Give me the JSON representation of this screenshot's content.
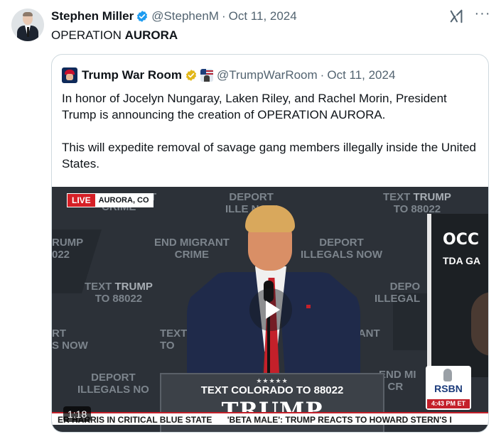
{
  "post": {
    "author_name": "Stephen Miller",
    "handle": "@StephenM",
    "separator": "·",
    "date": "Oct 11, 2024",
    "text_prefix": "OPERATION ",
    "text_bold": "AURORA",
    "more_label": "···"
  },
  "quote": {
    "author_name": "Trump War Room",
    "handle": "@TrumpWarRoom",
    "separator": "·",
    "date": "Oct 11, 2024",
    "paragraph1": "In honor of Jocelyn Nungaray, Laken Riley, and Rachel Morin, President Trump is announcing the creation of OPERATION AURORA.",
    "paragraph2": "This will expedite removal of savage gang members illegally inside the United States."
  },
  "video": {
    "live_label": "LIVE",
    "location": "AURORA, CO",
    "duration": "1:18",
    "bg_crime": "CRIME",
    "bg_deport": "DEPORT",
    "bg_illeg_now": "ILLE    NOW",
    "bg_text": "TEXT ",
    "bg_trump": "TRUMP",
    "bg_to": "TO 88022",
    "bg_rump": "RUMP",
    "bg_022": "022",
    "bg_end_migrant": "END MIGRANT",
    "bg_illegals_now": "ILLEGALS NOW",
    "bg_depo": "DEPO",
    "bg_illegal": "ILLEGAL",
    "bg_rt": "RT",
    "bg_s_now": "S NOW",
    "bg_text2": "TEXT",
    "bg_to2": "TO",
    "bg_rant": "RANT",
    "bg_e": "E",
    "bg_end_mi": "END MI",
    "bg_cr": "CR",
    "bg_illegals_no": "ILLEGALS NO",
    "bg_t": "T",
    "sign_word": "OCC",
    "sign_sub": "TDA GA",
    "podium_stars": "★★★★★",
    "podium_text_pre": "TEXT ",
    "podium_text_bold": "COLORADO",
    "podium_text_post": " TO 88022",
    "podium_trump": "TRUMP",
    "rsbn_label": "RSBN",
    "rsbn_time": "4:43 PM ET",
    "ticker": [
      "ER HARRIS IN CRITICAL BLUE STATE",
      "'BETA MALE': TRUMP REACTS TO HOWARD STERN'S I"
    ]
  },
  "colors": {
    "verified_blue": "#1d9bf0",
    "verified_gold": "#e2b719",
    "live_red": "#d61f26"
  },
  "icons": {
    "verified": "verified-badge-icon",
    "gold_verified": "gold-verified-badge-icon",
    "grok": "grok-icon",
    "more": "more-options-icon",
    "play": "play-icon"
  }
}
